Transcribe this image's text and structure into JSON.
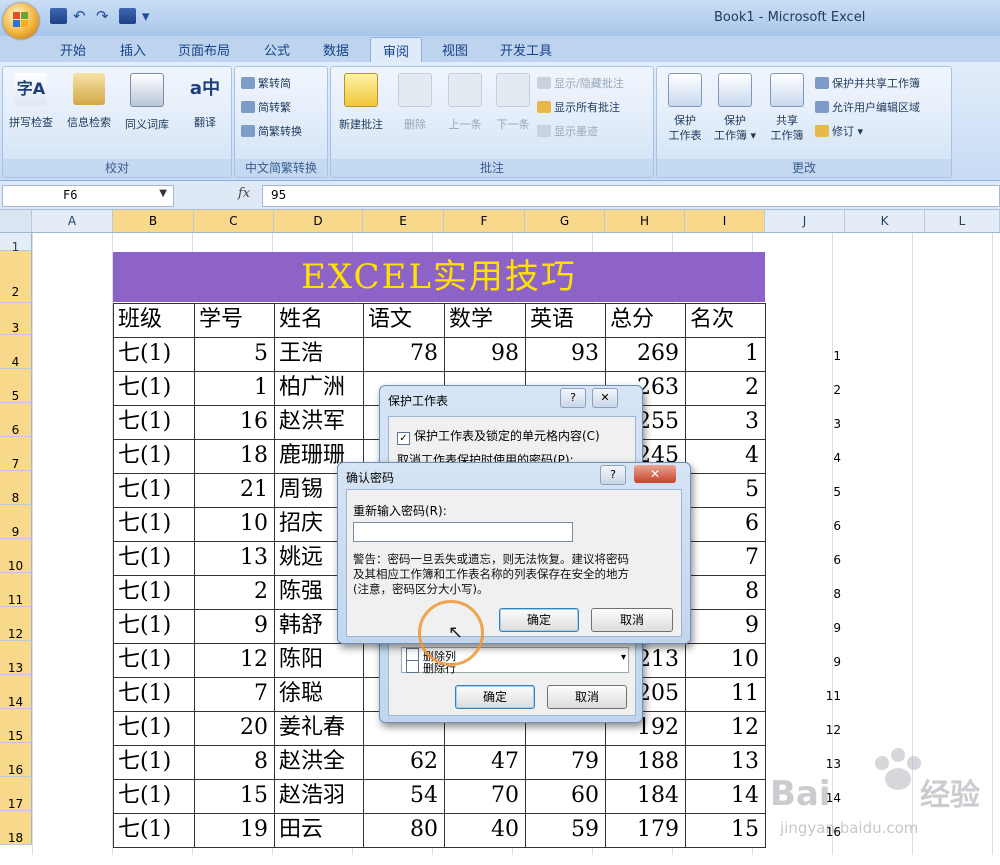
{
  "app": {
    "title": "Book1 - Microsoft Excel"
  },
  "tabs": [
    "开始",
    "插入",
    "页面布局",
    "公式",
    "数据",
    "审阅",
    "视图",
    "开发工具"
  ],
  "active_tab": "审阅",
  "ribbon": {
    "proofing": {
      "label": "校对",
      "buttons": [
        "拼写检查",
        "信息检索",
        "同义词库",
        "翻译"
      ]
    },
    "chinese": {
      "label": "中文简繁转换",
      "buttons": [
        "繁转简",
        "简转繁",
        "简繁转换"
      ]
    },
    "comments": {
      "label": "批注",
      "big_buttons": [
        "新建批注",
        "删除",
        "上一条",
        "下一条"
      ],
      "small_buttons": [
        "显示/隐藏批注",
        "显示所有批注",
        "显示墨迹"
      ]
    },
    "changes": {
      "label": "更改",
      "big_buttons": [
        "保护\n工作表",
        "保护\n工作簿 ▾",
        "共享\n工作簿"
      ],
      "small_buttons": [
        "保护并共享工作簿",
        "允许用户编辑区域",
        "修订 ▾"
      ]
    }
  },
  "formula_bar": {
    "name_box": "F6",
    "fx": "fx",
    "value": "95"
  },
  "columns": [
    "A",
    "B",
    "C",
    "D",
    "E",
    "F",
    "G",
    "H",
    "I",
    "J",
    "K",
    "L"
  ],
  "rows": [
    "1",
    "2",
    "3",
    "4",
    "5",
    "6",
    "7",
    "8",
    "9",
    "10",
    "11",
    "12",
    "13",
    "14",
    "15",
    "16",
    "17",
    "18"
  ],
  "sheet": {
    "title": "EXCEL实用技巧",
    "headers": [
      "班级",
      "学号",
      "姓名",
      "语文",
      "数学",
      "英语",
      "总分",
      "名次"
    ],
    "data": [
      [
        "七(1)",
        "5",
        "王浩",
        "78",
        "98",
        "93",
        "269",
        "1"
      ],
      [
        "七(1)",
        "1",
        "柏广洲",
        "",
        "",
        "",
        "263",
        "2"
      ],
      [
        "七(1)",
        "16",
        "赵洪军",
        "",
        "",
        "",
        "255",
        "3"
      ],
      [
        "七(1)",
        "18",
        "鹿珊珊",
        "",
        "",
        "",
        "245",
        "4"
      ],
      [
        "七(1)",
        "21",
        "周锡",
        "",
        "",
        "",
        "",
        "5"
      ],
      [
        "七(1)",
        "10",
        "招庆",
        "",
        "",
        "",
        "",
        "6"
      ],
      [
        "七(1)",
        "13",
        "姚远",
        "",
        "",
        "",
        "",
        "7"
      ],
      [
        "七(1)",
        "2",
        "陈强",
        "",
        "",
        "",
        "",
        "8"
      ],
      [
        "七(1)",
        "9",
        "韩舒",
        "",
        "",
        "",
        "",
        "9"
      ],
      [
        "七(1)",
        "12",
        "陈阳",
        "",
        "",
        "",
        "213",
        "10"
      ],
      [
        "七(1)",
        "7",
        "徐聪",
        "",
        "",
        "",
        "205",
        "11"
      ],
      [
        "七(1)",
        "20",
        "姜礼春",
        "",
        "",
        "",
        "192",
        "12"
      ],
      [
        "七(1)",
        "8",
        "赵洪全",
        "62",
        "47",
        "79",
        "188",
        "13"
      ],
      [
        "七(1)",
        "15",
        "赵浩羽",
        "54",
        "70",
        "60",
        "184",
        "14"
      ],
      [
        "七(1)",
        "19",
        "田云",
        "80",
        "40",
        "59",
        "179",
        "15"
      ]
    ],
    "col_j": [
      "1",
      "2",
      "3",
      "4",
      "5",
      "6",
      "6",
      "8",
      "9",
      "9",
      "11",
      "12",
      "13",
      "14",
      "16"
    ]
  },
  "protect_dialog": {
    "title": "保护工作表",
    "help": "?",
    "close": "✕",
    "checkbox_label": "保护工作表及锁定的单元格内容(C)",
    "password_label": "取消工作表保护时使用的密码(P):",
    "list_items": [
      "删除列",
      "删除行"
    ],
    "ok": "确定",
    "cancel": "取消"
  },
  "confirm_dialog": {
    "title": "确认密码",
    "help": "?",
    "close": "✕",
    "reenter_label": "重新输入密码(R):",
    "warning": [
      "警告：密码一旦丢失或遗忘，则无法恢复。建议将密码",
      "及其相应工作簿和工作表名称的列表保存在安全的地方",
      "(注意，密码区分大小写)。"
    ],
    "ok": "确定",
    "cancel": "取消"
  },
  "watermark": {
    "brand": "Baidu经验",
    "url": "jingyan.baidu.com"
  }
}
